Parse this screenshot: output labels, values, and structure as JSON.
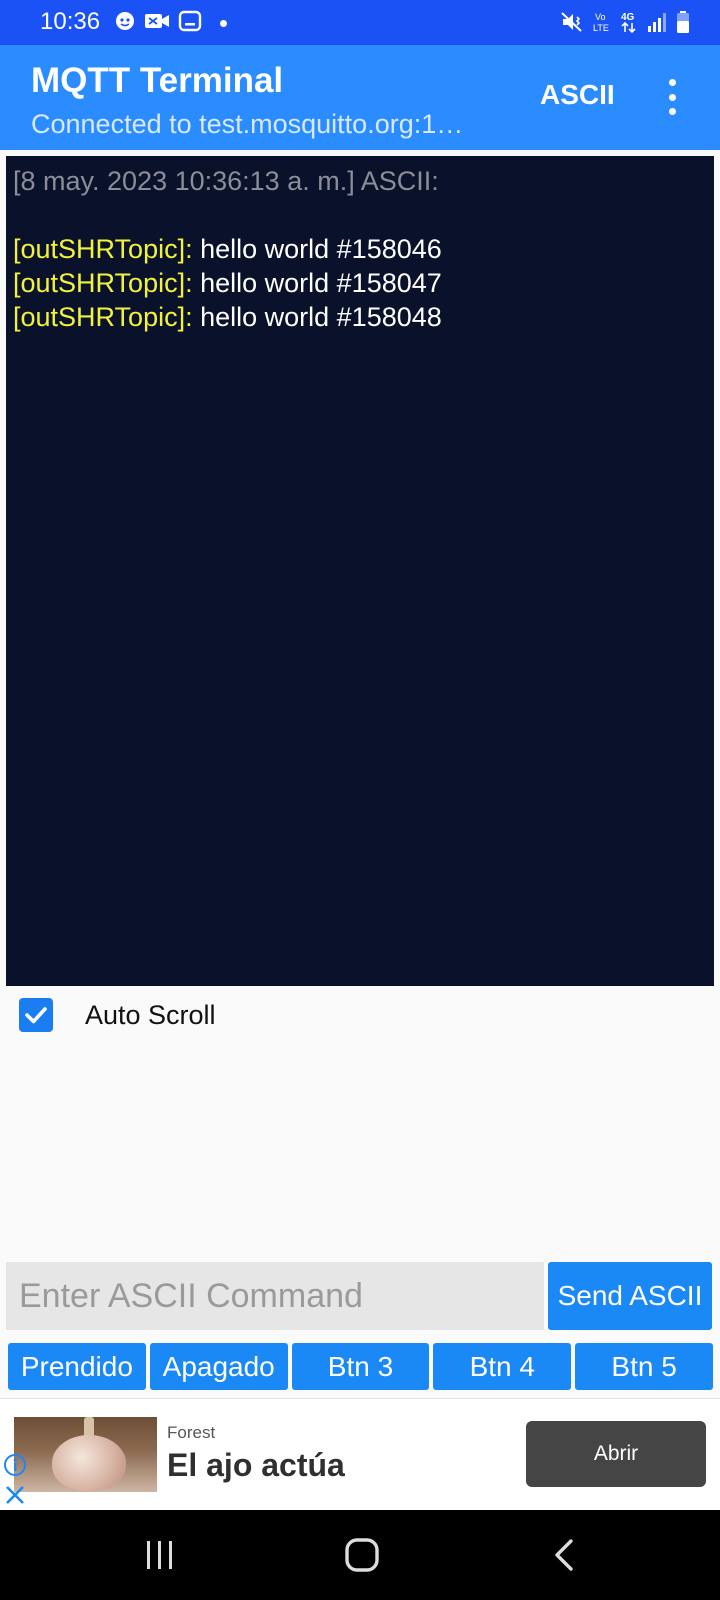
{
  "status_bar": {
    "time": "10:36"
  },
  "app_bar": {
    "title": "MQTT Terminal",
    "subtitle": "Connected to test.mosquitto.org:1…",
    "mode_button": "ASCII"
  },
  "terminal": {
    "header": "[8 may. 2023 10:36:13 a. m.] ASCII:",
    "lines": [
      {
        "topic": "[outSHRTopic]:",
        "message": " hello world #158046"
      },
      {
        "topic": "[outSHRTopic]:",
        "message": " hello world #158047"
      },
      {
        "topic": "[outSHRTopic]:",
        "message": " hello world #158048"
      }
    ]
  },
  "autoscroll": {
    "label": "Auto Scroll",
    "checked": true
  },
  "command": {
    "placeholder": "Enter ASCII Command",
    "value": "",
    "send_label": "Send ASCII"
  },
  "macro_buttons": [
    "Prendido",
    "Apagado",
    "Btn 3",
    "Btn 4",
    "Btn 5"
  ],
  "ad": {
    "source": "Forest",
    "headline": "El ajo actúa",
    "cta": "Abrir"
  },
  "colors": {
    "status_bar": "#1a52f5",
    "app_bar": "#2a8cff",
    "terminal_bg": "#0a112a",
    "topic_text": "#f2f23c",
    "button": "#1a88f5"
  },
  "icons": {
    "status_left": [
      "face-notification-icon",
      "video-call-icon",
      "tablet-icon",
      "dot-icon"
    ],
    "status_right": [
      "mute-vibrate-icon",
      "volte-icon",
      "4g-data-icon",
      "signal-icon",
      "battery-icon"
    ],
    "nav": [
      "recents-icon",
      "home-icon",
      "back-icon"
    ]
  }
}
